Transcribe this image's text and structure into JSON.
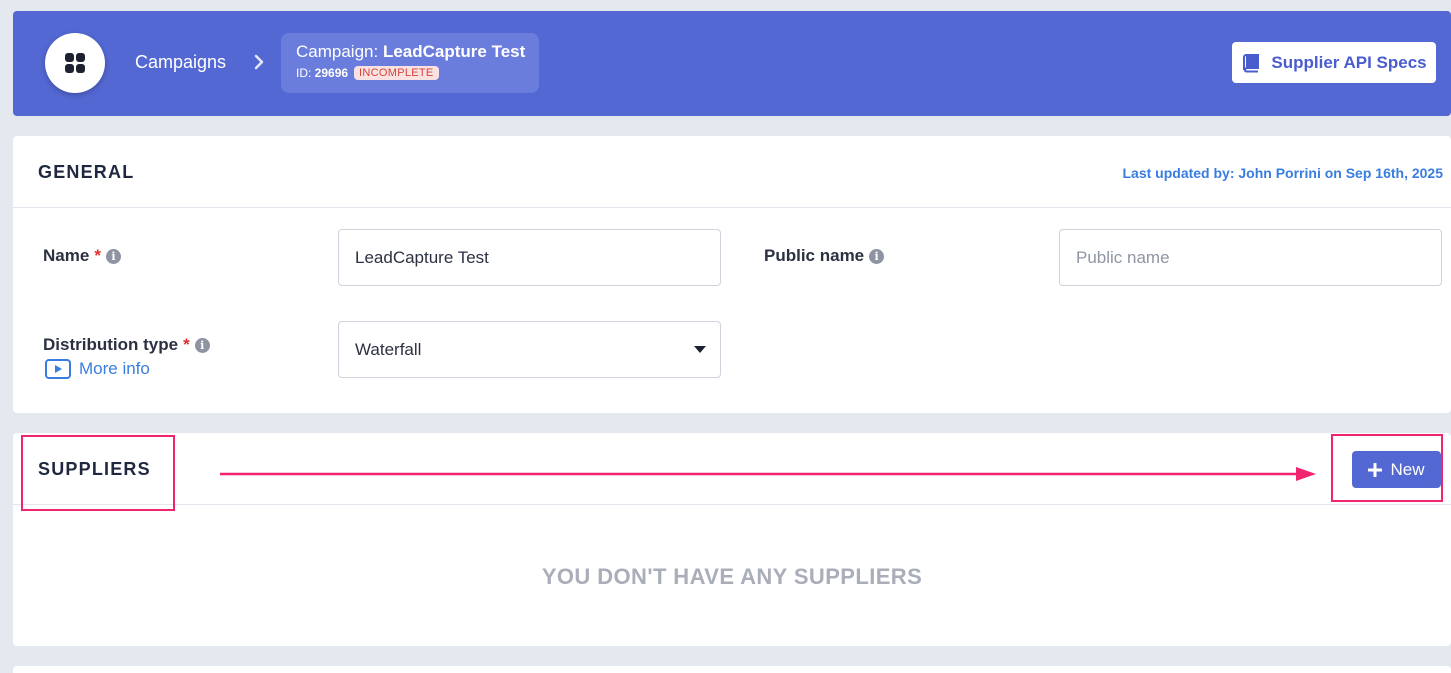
{
  "header": {
    "breadcrumb_campaigns": "Campaigns",
    "campaign_prefix": "Campaign: ",
    "campaign_name": "LeadCapture Test",
    "id_prefix": "ID: ",
    "campaign_id": "29696",
    "status": "INCOMPLETE",
    "api_specs_label": "Supplier API Specs",
    "icons": [
      "apps-grid-icon",
      "chevron-right-icon",
      "book-icon"
    ]
  },
  "general": {
    "title": "GENERAL",
    "last_updated": "Last updated by: John Porrini on Sep 16th, 2025",
    "name_label": "Name",
    "name_value": "LeadCapture Test",
    "public_name_label": "Public name",
    "public_name_placeholder": "Public name",
    "distribution_label": "Distribution type",
    "distribution_value": "Waterfall",
    "more_info": "More info",
    "required_mark": "*",
    "info_glyph": "i"
  },
  "suppliers": {
    "title": "SUPPLIERS",
    "new_label": "New",
    "empty_message": "YOU DON'T HAVE ANY SUPPLIERS"
  },
  "colors": {
    "brand": "#5468d4",
    "link": "#3a7de0",
    "annotation": "#f0246f",
    "status_text": "#d0453a"
  }
}
